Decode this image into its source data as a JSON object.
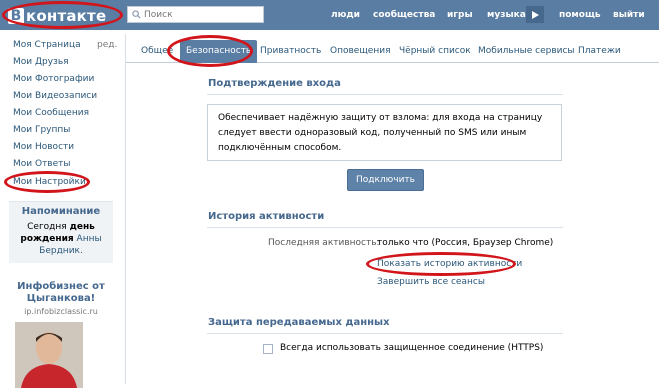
{
  "header": {
    "logo_letter": "B",
    "logo_text": "контакте",
    "search_placeholder": "Поиск",
    "nav": [
      "люди",
      "сообщества",
      "игры",
      "музыка",
      "помощь",
      "выйти"
    ]
  },
  "sidebar": {
    "items": [
      "Моя Страница",
      "Мои Друзья",
      "Мои Фотографии",
      "Мои Видеозаписи",
      "Мои Сообщения",
      "Мои Группы",
      "Мои Новости",
      "Мои Ответы",
      "Мои Настройки"
    ],
    "edit_label": "ред.",
    "reminder": {
      "title": "Напоминание",
      "line1_prefix": "Сегодня",
      "line1_suffix": "день",
      "line2_prefix": "рождения",
      "name1": "Анны",
      "name2": "Бердник."
    },
    "ad": {
      "title_line1": "Инфобизнес от",
      "title_line2": "Цыганкова!",
      "url": "ip.infobizclassic.ru"
    }
  },
  "tabs": [
    "Общее",
    "Безопасность",
    "Приватность",
    "Оповещения",
    "Чёрный список",
    "Мобильные сервисы",
    "Платежи"
  ],
  "active_tab": "Безопасность",
  "login_confirmation": {
    "title": "Подтверждение входа",
    "description": "Обеспечивает надёжную защиту от взлома: для входа на страницу следует ввести одноразовый код, полученный по SMS или иным подключённым способом.",
    "button": "Подключить"
  },
  "activity": {
    "title": "История активности",
    "last_label": "Последняя активность:",
    "last_value": "только что (Россия, Браузер Chrome)",
    "show_link": "Показать историю активности",
    "end_sessions_link": "Завершить все сеансы"
  },
  "data_protection": {
    "title": "Защита передаваемых данных",
    "https_label": "Всегда использовать защищенное соединение (HTTPS)",
    "https_checked": false
  },
  "colors": {
    "header_bg": "#597da3",
    "link": "#2b587a",
    "highlight": "#d1151a"
  }
}
